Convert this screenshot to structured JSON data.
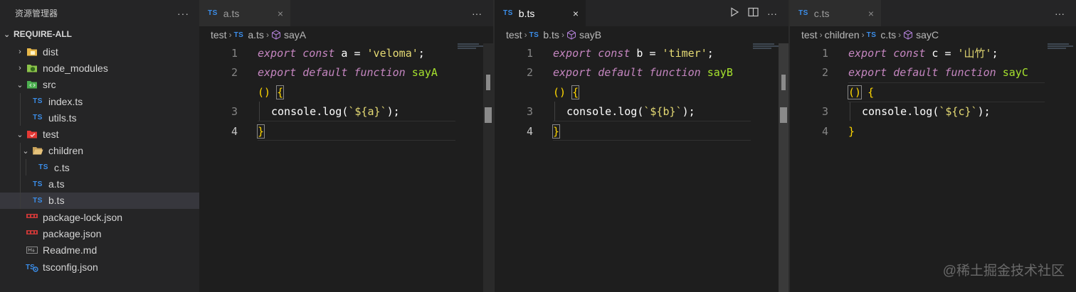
{
  "explorer": {
    "title": "资源管理器",
    "more": "···",
    "root": "REQUIRE-ALL",
    "items": [
      {
        "label": "dist"
      },
      {
        "label": "node_modules"
      },
      {
        "label": "src"
      },
      {
        "label": "index.ts"
      },
      {
        "label": "utils.ts"
      },
      {
        "label": "test"
      },
      {
        "label": "children"
      },
      {
        "label": "c.ts"
      },
      {
        "label": "a.ts"
      },
      {
        "label": "b.ts"
      },
      {
        "label": "package-lock.json"
      },
      {
        "label": "package.json"
      },
      {
        "label": "Readme.md"
      },
      {
        "label": "tsconfig.json"
      }
    ]
  },
  "ts_badge": "TS",
  "tab_more": "···",
  "tab_close": "×",
  "breadcrumb_sep": "›",
  "group1": {
    "tab": "a.ts",
    "crumbs": {
      "folder": "test",
      "file": "a.ts",
      "symbol": "sayA"
    },
    "line_numbers": [
      "1",
      "2",
      "3",
      "4"
    ],
    "code": {
      "l1_kw1": "export",
      "l1_kw2": "const",
      "l1_id": "a",
      "l1_eq": " = ",
      "l1_str": "'veloma'",
      "l1_end": ";",
      "l2_kw1": "export",
      "l2_kw2": "default",
      "l2_kw3": "function",
      "l2_fn": "sayA",
      "l2b_paren": "()",
      "l2b_brace": "{",
      "l3_obj": "console.log(",
      "l3_tpl": "`${a}`",
      "l3_end": ");",
      "l4_brace": "}"
    }
  },
  "group2": {
    "tab": "b.ts",
    "crumbs": {
      "folder": "test",
      "file": "b.ts",
      "symbol": "sayB"
    },
    "line_numbers": [
      "1",
      "2",
      "3",
      "4"
    ],
    "code": {
      "l1_kw1": "export",
      "l1_kw2": "const",
      "l1_id": "b",
      "l1_eq": " = ",
      "l1_str": "'timer'",
      "l1_end": ";",
      "l2_kw1": "export",
      "l2_kw2": "default",
      "l2_kw3": "function",
      "l2_fn": "sayB",
      "l2b_paren": "()",
      "l2b_brace": "{",
      "l3_obj": "console.log(",
      "l3_tpl": "`${b}`",
      "l3_end": ");",
      "l4_brace": "}"
    }
  },
  "group3": {
    "tab": "c.ts",
    "crumbs": {
      "folder": "test",
      "subfolder": "children",
      "file": "c.ts",
      "symbol": "sayC"
    },
    "line_numbers": [
      "1",
      "2",
      "3",
      "4"
    ],
    "code": {
      "l1_kw1": "export",
      "l1_kw2": "const",
      "l1_id": "c",
      "l1_eq": " = ",
      "l1_str": "'山竹'",
      "l1_end": ";",
      "l2_kw1": "export",
      "l2_kw2": "default",
      "l2_kw3": "function",
      "l2_fn": "sayC",
      "l2b_paren": "()",
      "l2b_brace": "{",
      "l3_obj": "console.log(",
      "l3_tpl": "`${c}`",
      "l3_end": ");",
      "l4_brace": "}"
    }
  },
  "watermark": "@稀土掘金技术社区",
  "colors": {
    "keyword": "#c586c0",
    "string": "#e6db74",
    "function": "#a6e22e",
    "ts_icon": "#3b8eea"
  }
}
